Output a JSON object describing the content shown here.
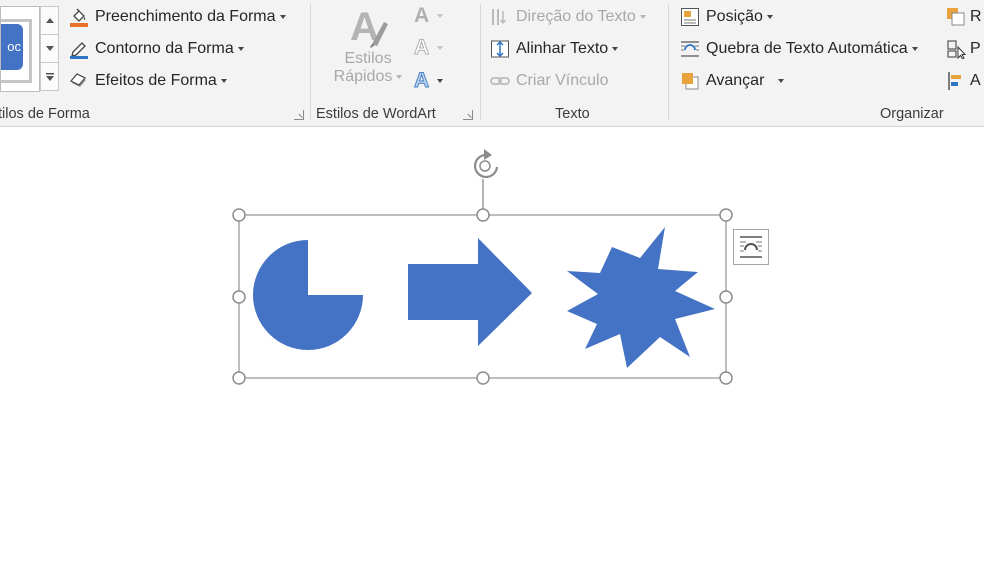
{
  "ribbon": {
    "shape_styles": {
      "gallery_thumb_text": "oc",
      "fill_label": "Preenchimento da Forma",
      "outline_label": "Contorno da Forma",
      "effects_label": "Efeitos de Forma",
      "group_label": "tilos de Forma"
    },
    "wordart": {
      "quick_styles_line1": "Estilos",
      "quick_styles_line2": "Rápidos",
      "group_label": "Estilos de WordArt"
    },
    "text": {
      "direction_label": "Direção do Texto",
      "align_label": "Alinhar Texto",
      "link_label": "Criar Vínculo",
      "group_label": "Texto"
    },
    "arrange": {
      "position_label": "Posição",
      "wrap_label": "Quebra de Texto Automática",
      "forward_label": "Avançar",
      "partial_1": "R",
      "partial_2": "P",
      "partial_3": "A",
      "group_label": "Organizar"
    }
  },
  "colors": {
    "shape_fill": "#4472c4",
    "handle_stroke": "#8c8c8c",
    "ribbon_bg": "#f3f3f3",
    "disabled_text": "#a8a8a8"
  },
  "icons": {
    "fill": "paint-bucket-icon",
    "outline": "pen-outline-icon",
    "effects": "shape-effects-icon",
    "quick_styles": "wordart-quick-styles-icon",
    "text_direction": "text-direction-icon",
    "align_text": "align-text-icon",
    "create_link": "chain-link-icon",
    "position": "position-icon",
    "wrap_text": "wrap-text-icon",
    "bring_forward": "bring-forward-icon",
    "rotate_handle": "rotate-icon",
    "layout_options": "layout-options-icon"
  }
}
